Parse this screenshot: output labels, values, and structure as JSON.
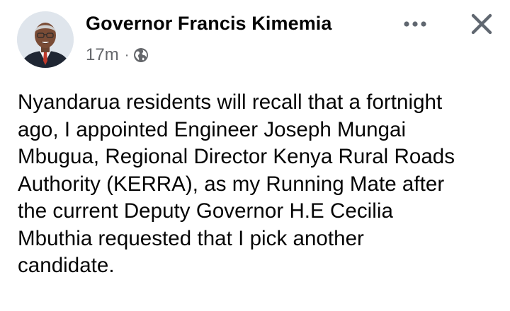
{
  "post": {
    "author_name": "Governor Francis Kimemia",
    "timestamp": "17m",
    "separator": "·",
    "audience_icon": "globe-icon",
    "more_icon": "more-horizontal-icon",
    "close_icon": "close-icon",
    "avatar_alt": "Governor Francis Kimemia profile photo",
    "body_lines": [
      "Nyandarua residents will recall that a fortnight",
      "ago, I appointed Engineer Joseph Mungai",
      "Mbugua, Regional Director Kenya Rural Roads",
      "Authority (KERRA), as my Running Mate after",
      "the current Deputy Governor H.E Cecilia",
      "Mbuthia requested that I pick another",
      "candidate."
    ]
  },
  "colors": {
    "text_primary": "#050505",
    "text_secondary": "#65676b",
    "icon": "#606770",
    "background": "#ffffff"
  }
}
